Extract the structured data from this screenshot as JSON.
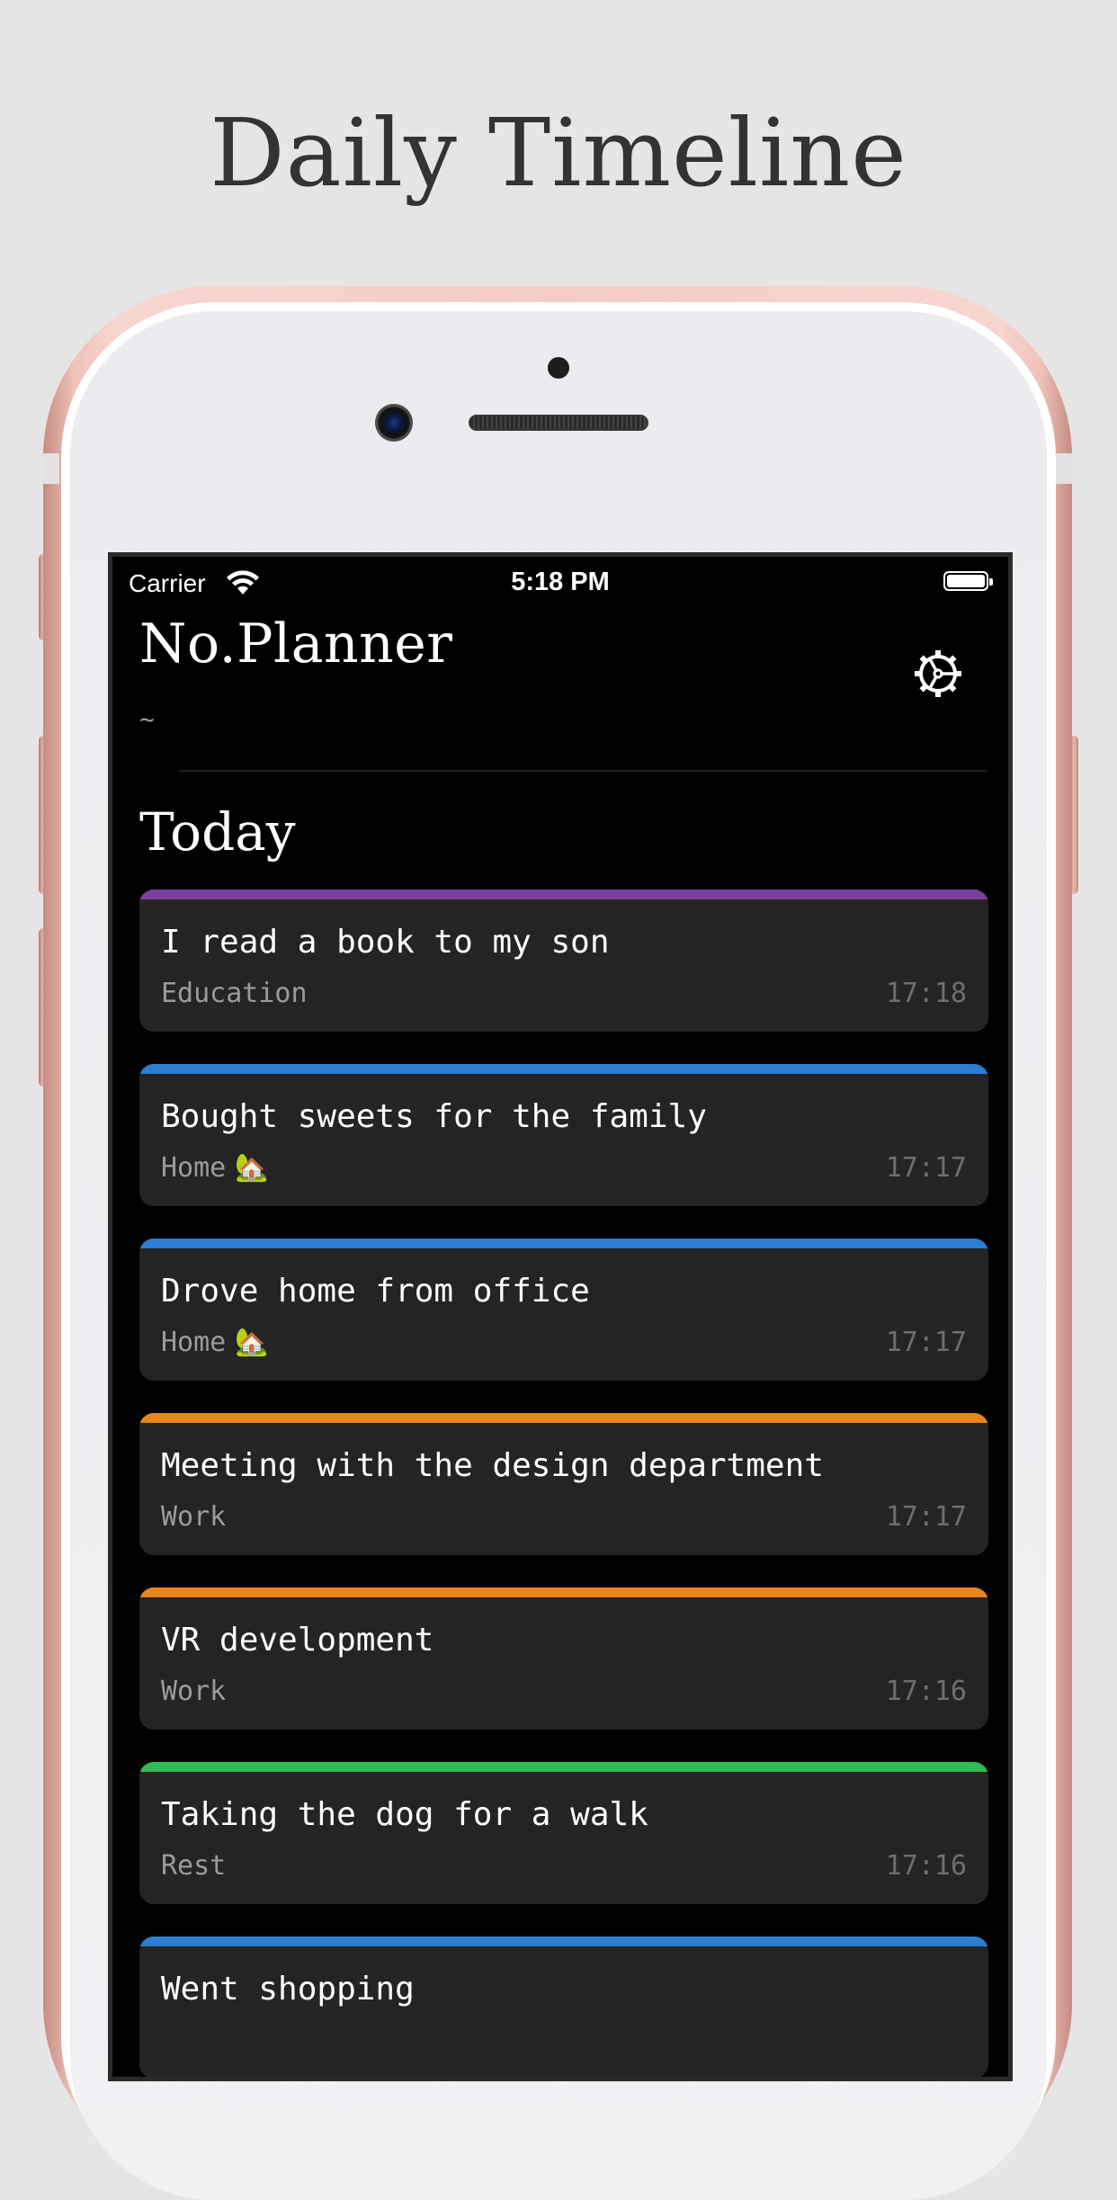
{
  "promo": {
    "title": "Daily Timeline"
  },
  "status_bar": {
    "carrier": "Carrier",
    "time": "5:18 PM"
  },
  "app": {
    "title": "No.Planner",
    "subtitle": "~",
    "settings_icon": "gear-icon"
  },
  "section": {
    "title": "Today"
  },
  "entries": [
    {
      "title": "I read a book to my son",
      "category": "Education",
      "emoji": "",
      "time": "17:18",
      "color": "#7b3fa0"
    },
    {
      "title": "Bought sweets for the family",
      "category": "Home",
      "emoji": "🏡",
      "time": "17:17",
      "color": "#2d7dd2"
    },
    {
      "title": "Drove home from office",
      "category": "Home",
      "emoji": "🏡",
      "time": "17:17",
      "color": "#2d7dd2"
    },
    {
      "title": "Meeting with the design department",
      "category": "Work",
      "emoji": "",
      "time": "17:17",
      "color": "#e8861b"
    },
    {
      "title": "VR development",
      "category": "Work",
      "emoji": "",
      "time": "17:16",
      "color": "#e8861b"
    },
    {
      "title": "Taking the dog for a walk",
      "category": "Rest",
      "emoji": "",
      "time": "17:16",
      "color": "#2fba54"
    },
    {
      "title": "Went shopping",
      "category": "",
      "emoji": "",
      "time": "",
      "color": "#2d7dd2"
    }
  ],
  "colors": {
    "background": "#e6e5e6",
    "screen": "#000000",
    "card": "#242424",
    "education": "#7b3fa0",
    "home": "#2d7dd2",
    "work": "#e8861b",
    "rest": "#2fba54"
  }
}
